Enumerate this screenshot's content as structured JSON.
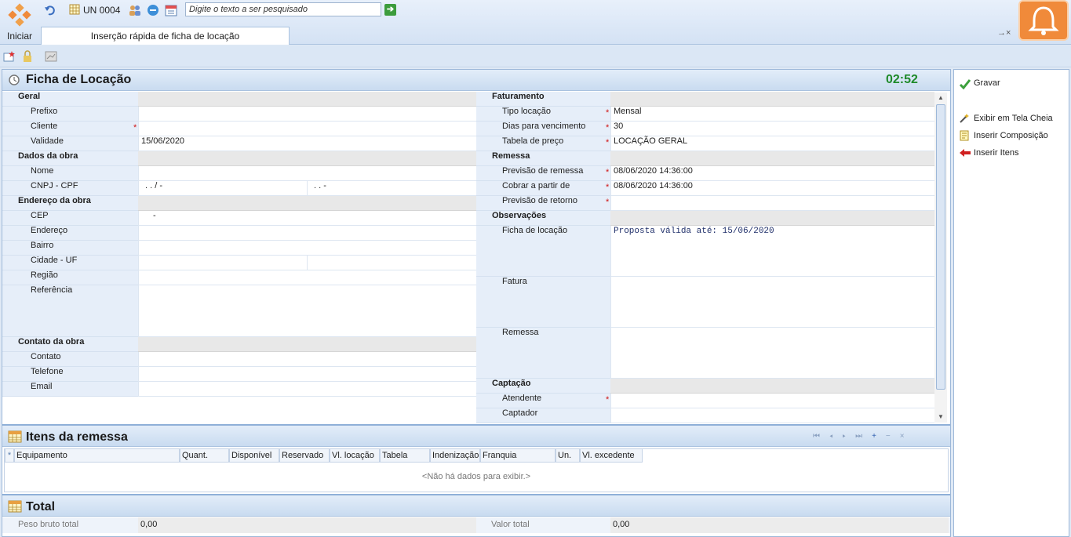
{
  "topbar": {
    "start_label": "Iniciar",
    "unit_label": "UN 0004",
    "search_placeholder": "Digite o texto a ser pesquisado",
    "tab_label": "Inserção rápida de ficha de locação",
    "tab_close": "→×"
  },
  "ficha": {
    "title": "Ficha de Locação",
    "timer": "02:52"
  },
  "left": {
    "geral": "Geral",
    "prefixo": "Prefixo",
    "cliente": "Cliente",
    "validade": "Validade",
    "validade_value": "15/06/2020",
    "dados_obra": "Dados da obra",
    "nome": "Nome",
    "cnpj": "CNPJ - CPF",
    "cnpj_value": ". . /  -",
    "cpf_value": ". . -",
    "endereco_obra": "Endereço da obra",
    "cep": "CEP",
    "cep_value": "-",
    "endereco": "Endereço",
    "bairro": "Bairro",
    "cidade": "Cidade - UF",
    "regiao": "Região",
    "referencia": "Referência",
    "contato_obra": "Contato da obra",
    "contato": "Contato",
    "telefone": "Telefone",
    "email": "Email"
  },
  "right": {
    "faturamento": "Faturamento",
    "tipo_locacao": "Tipo locação",
    "tipo_locacao_value": "Mensal",
    "dias_vencimento": "Dias para vencimento",
    "dias_vencimento_value": "30",
    "tabela_preco": "Tabela de preço",
    "tabela_preco_value": "LOCAÇÃO GERAL",
    "remessa": "Remessa",
    "previsao_remessa": "Previsão de remessa",
    "previsao_remessa_value": "08/06/2020 14:36:00",
    "cobrar_partir": "Cobrar a partir de",
    "cobrar_partir_value": "08/06/2020 14:36:00",
    "previsao_retorno": "Previsão de retorno",
    "observacoes": "Observações",
    "obs_ficha": "Ficha de locação",
    "obs_ficha_value": "Proposta válida até: 15/06/2020",
    "obs_fatura": "Fatura",
    "obs_remessa": "Remessa",
    "captacao": "Captação",
    "atendente": "Atendente",
    "captador": "Captador"
  },
  "itens": {
    "title": "Itens da remessa",
    "columns": [
      "Equipamento",
      "Quant.",
      "Disponível",
      "Reservado",
      "Vl. locação",
      "Tabela",
      "Indenização",
      "Franquia",
      "Un.",
      "Vl. excedente"
    ],
    "empty": "<Não há dados para exibir.>"
  },
  "total": {
    "title": "Total",
    "peso_label": "Peso bruto total",
    "peso_value": "0,00",
    "valor_label": "Valor total",
    "valor_value": "0,00"
  },
  "actions": {
    "gravar": "Gravar",
    "tela_cheia": "Exibir em Tela Cheia",
    "composicao": "Inserir Composição",
    "itens": "Inserir Itens"
  },
  "colors": {
    "accent": "#f08a3a",
    "timer": "#1f8a2a",
    "required": "#d01414"
  }
}
